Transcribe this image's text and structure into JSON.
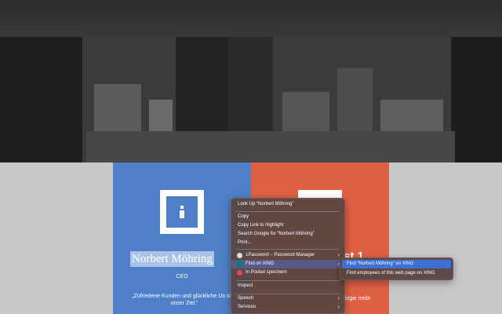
{
  "profile": {
    "name": "Norbert Möhring",
    "role": "CEO",
    "quote": "„Zufriedene Kunden und glückliche Us sind unser Ziel.“"
  },
  "red_card": {
    "title": "st.1",
    "text": "ologie treibt"
  },
  "context_menu": {
    "look_up": "Look Up “Norbert Möhring”",
    "copy": "Copy",
    "copy_link": "Copy Link to Highlight",
    "search_google": "Search Google for “Norbert Möhring”",
    "print": "Print...",
    "onepassword": "1Password – Password Manager",
    "find_xing": "Find on XING",
    "pocket": "In Pocket speichern",
    "inspect": "Inspect",
    "speech": "Speech",
    "services": "Services"
  },
  "submenu": {
    "find_name": "Find “Norbert Möhring” on XING",
    "find_employees": "Find employees of this web page on XING"
  },
  "colors": {
    "blue_card": "#4f7fc6",
    "red_card": "#df5f45",
    "highlight": "#3e6fd4"
  },
  "icons": {
    "onepassword": "onepassword-icon",
    "xing": "xing-icon",
    "pocket": "pocket-icon",
    "submenu_arrow": "chevron-right-icon"
  }
}
